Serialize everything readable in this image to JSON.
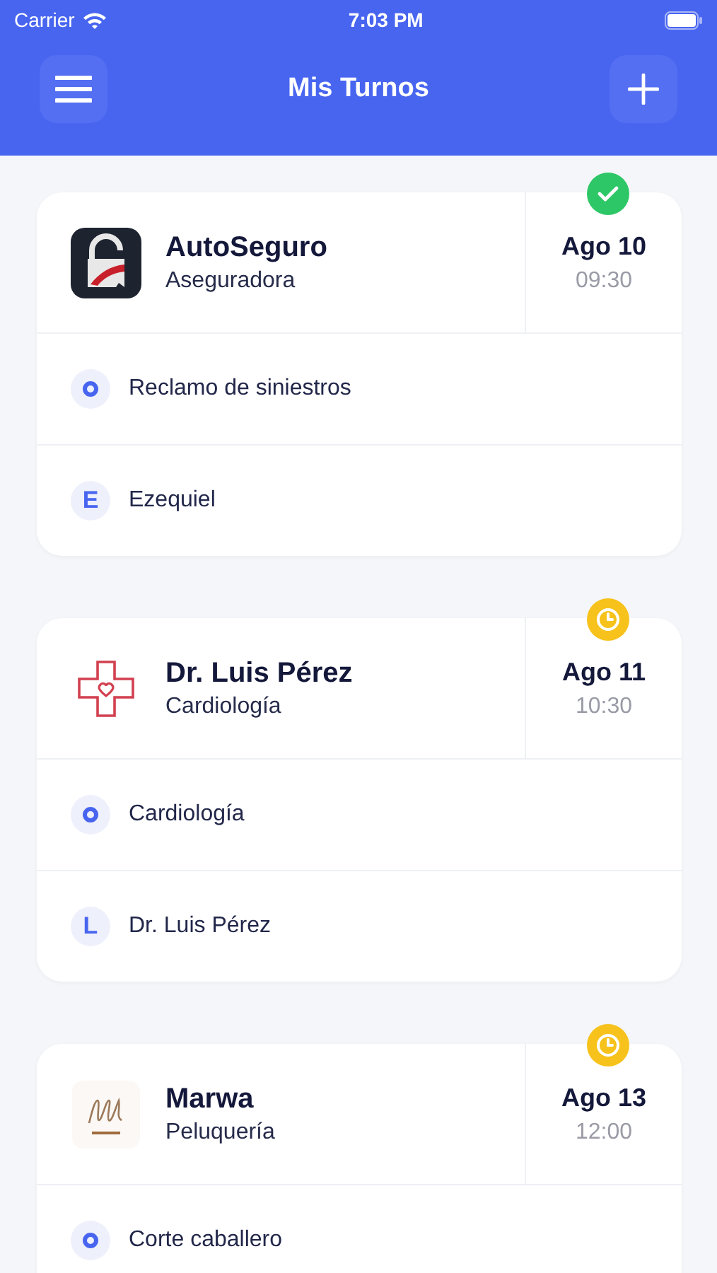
{
  "status_bar": {
    "carrier": "Carrier",
    "time": "7:03 PM"
  },
  "header": {
    "title": "Mis Turnos"
  },
  "appointments": [
    {
      "kind": "lock",
      "name": "AutoSeguro",
      "category": "Aseguradora",
      "date": "Ago 10",
      "time": "09:30",
      "confirmed": true,
      "details": [
        {
          "kind": "service",
          "text": "Reclamo de siniestros"
        },
        {
          "kind": "person",
          "initial": "E",
          "text": "Ezequiel"
        }
      ]
    },
    {
      "kind": "cross",
      "name": "Dr. Luis Pérez",
      "category": "Cardiología",
      "date": "Ago 11",
      "time": "10:30",
      "confirmed": false,
      "details": [
        {
          "kind": "service",
          "text": "Cardiología"
        },
        {
          "kind": "person",
          "initial": "L",
          "text": "Dr. Luis Pérez"
        }
      ]
    },
    {
      "kind": "script",
      "name": "Marwa",
      "category": "Peluquería",
      "date": "Ago 13",
      "time": "12:00",
      "confirmed": false,
      "details": [
        {
          "kind": "service",
          "text": "Corte caballero"
        }
      ]
    }
  ]
}
